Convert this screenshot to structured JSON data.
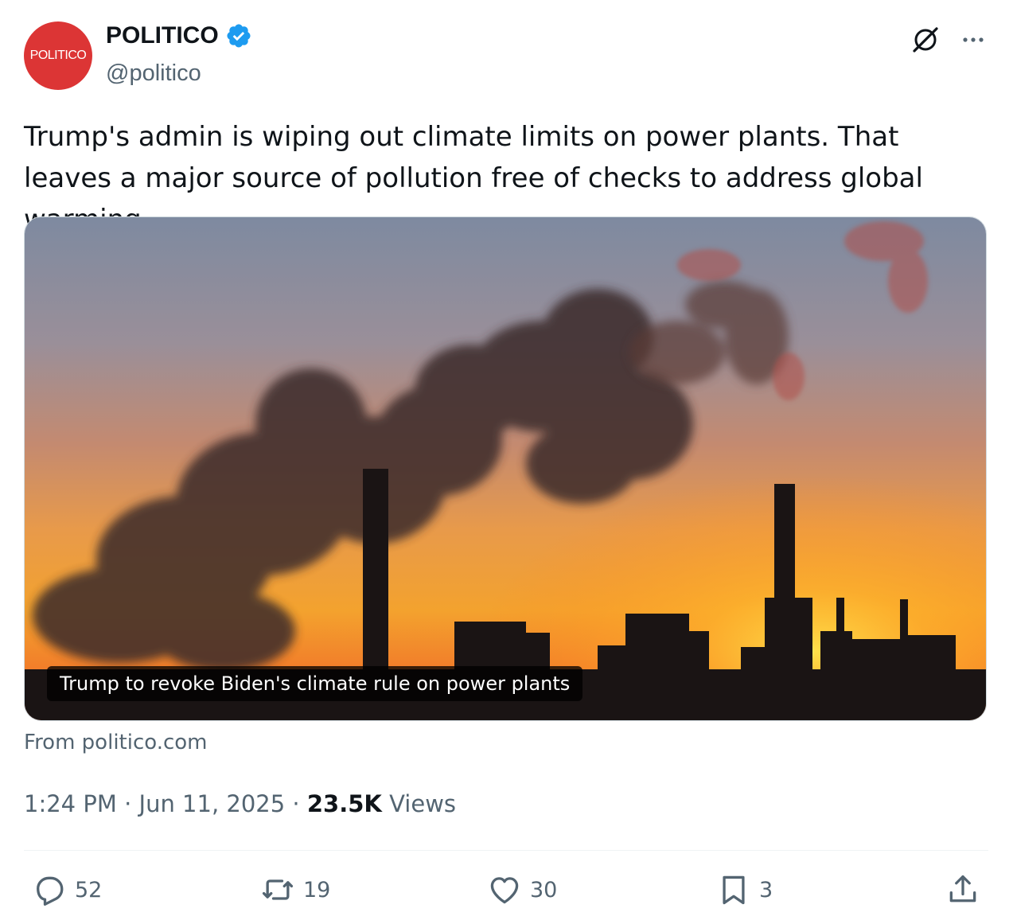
{
  "author": {
    "avatar_text": "POLITICO",
    "display_name": "POLITICO",
    "handle": "@politico",
    "brand_color": "#dc3535",
    "verified_color": "#1d9bf0"
  },
  "tweet": {
    "text": "Trump's admin is wiping out climate limits on power plants. That leaves a major source of pollution free of checks to address global warming.",
    "card_caption": "Trump to revoke Biden's climate rule on power plants",
    "source": "From politico.com",
    "time": "1:24 PM",
    "date": "Jun 11, 2025",
    "separator": "·",
    "views_count": "23.5K",
    "views_label": "Views"
  },
  "actions": {
    "replies": "52",
    "reposts": "19",
    "likes": "30",
    "bookmarks": "3"
  },
  "icons": [
    "grok-icon",
    "more-icon",
    "verified-badge-icon",
    "reply-icon",
    "repost-icon",
    "like-icon",
    "bookmark-icon",
    "share-icon"
  ]
}
